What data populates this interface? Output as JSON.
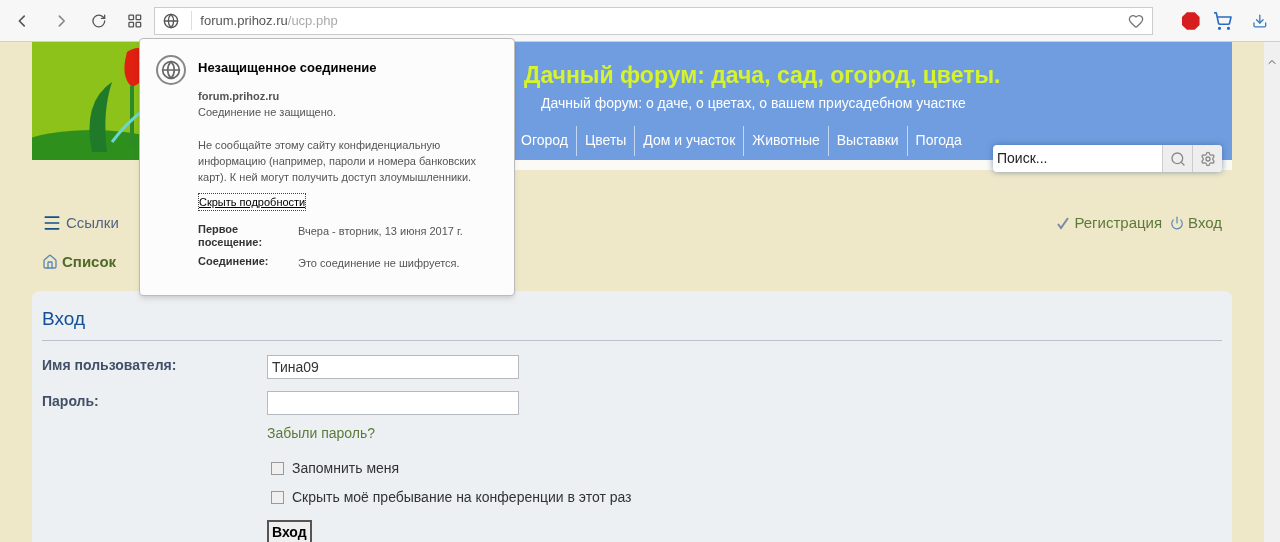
{
  "browser": {
    "url": {
      "host": "forum.prihoz.ru",
      "path": "/ucp.php"
    }
  },
  "security_popup": {
    "title": "Незащищенное соединение",
    "site": "forum.prihoz.ru",
    "status": "Соединение не защищено.",
    "warning": "Не сообщайте этому сайту конфиденциальную информацию (например, пароли и номера банковских карт). К ней могут получить доступ злоумышленники.",
    "details_link": "Скрыть подробности",
    "details": [
      {
        "label": "Первое посещение:",
        "value": "Вчера - вторник, 13 июня 2017 г."
      },
      {
        "label": "Соединение:",
        "value": "Это соединение не шифруется."
      }
    ]
  },
  "header": {
    "title": "Дачный форум: дача, сад, огород, цветы.",
    "subtitle": "Дачный форум: о даче, о цветах, о вашем приусадебном участке",
    "nav": [
      "Огород",
      "Цветы",
      "Дом и участок",
      "Животные",
      "Выставки",
      "Погода"
    ],
    "search": {
      "placeholder": "Поиск..."
    }
  },
  "links": {
    "menu": "Ссылки",
    "register": "Регистрация",
    "login": "Вход",
    "breadcrumb": "Список"
  },
  "login_panel": {
    "heading": "Вход",
    "username_label": "Имя пользователя:",
    "username": "Тина09",
    "password_label": "Пароль:",
    "forgot": "Забыли пароль?",
    "options": [
      {
        "label": "Запомнить меня",
        "checked": false
      },
      {
        "label": "Скрыть моё пребывание на конференции в этот раз",
        "checked": false
      }
    ],
    "submit": "Вход"
  }
}
